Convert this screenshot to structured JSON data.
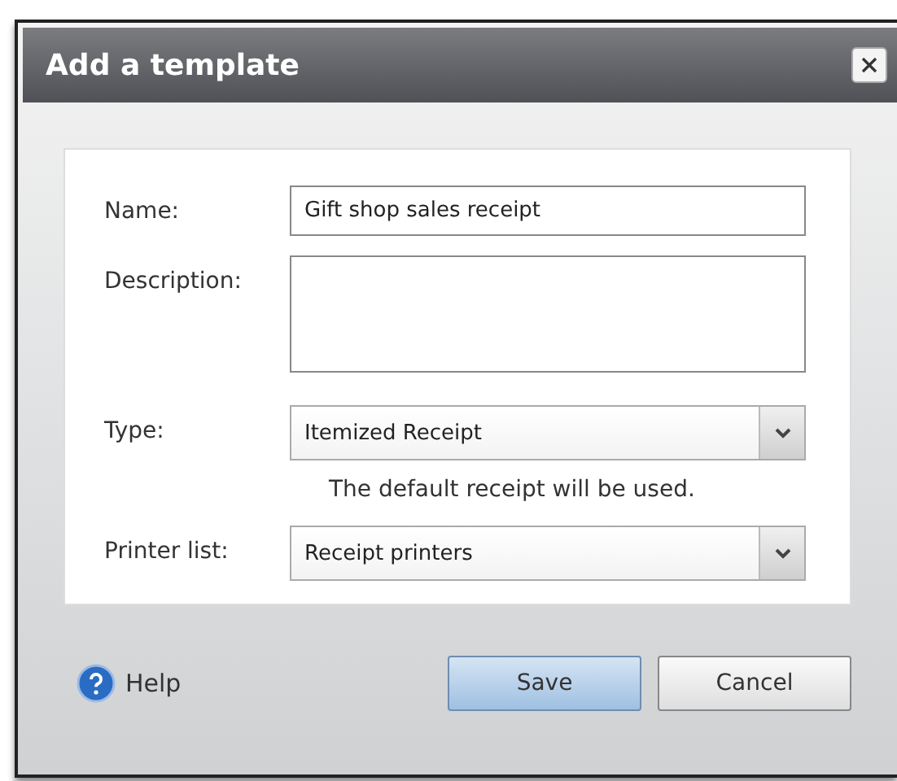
{
  "window": {
    "title": "Add a template"
  },
  "fields": [
    {
      "kind": "text",
      "label": "Name:",
      "value": "Gift shop sales receipt"
    },
    {
      "kind": "textarea",
      "label": "Description:"
    },
    {
      "kind": "select",
      "label": "Type:",
      "value": "Itemized Receipt",
      "note": "The default receipt will be used."
    },
    {
      "kind": "select",
      "label": "Printer list:",
      "value": "Receipt printers"
    }
  ],
  "help": {
    "label": "Help"
  },
  "buttons": [
    {
      "label": "Save",
      "kind": "primary"
    },
    {
      "label": "Cancel",
      "kind": "secondary"
    }
  ]
}
